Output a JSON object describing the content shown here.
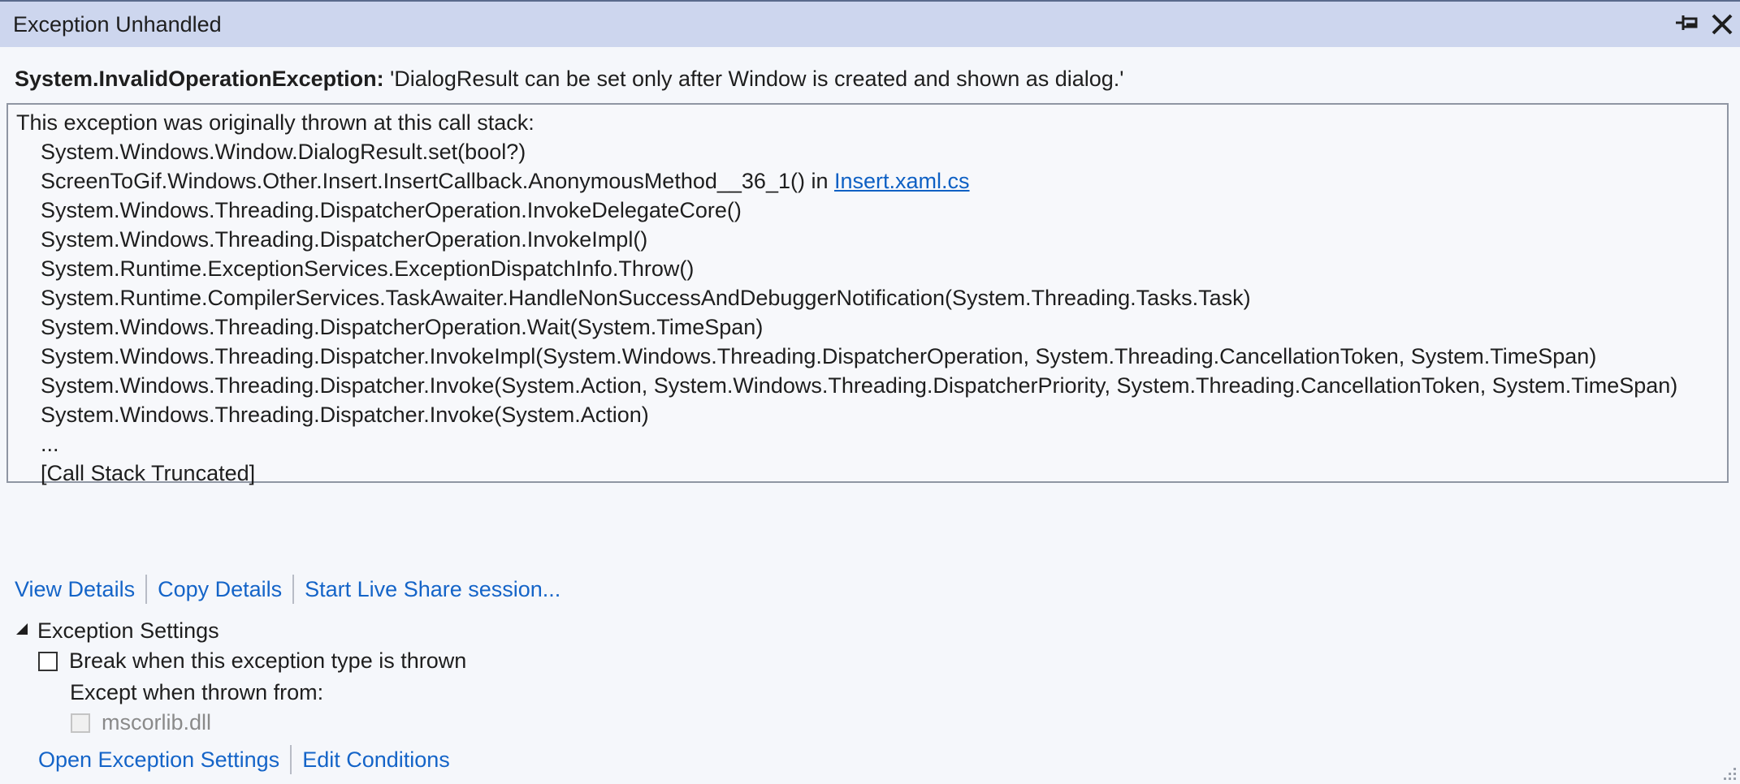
{
  "window": {
    "title": "Exception Unhandled"
  },
  "exception": {
    "type": "System.InvalidOperationException:",
    "message": "'DialogResult can be set only after Window is created and shown as dialog.'"
  },
  "call_stack": {
    "intro": "This exception was originally thrown at this call stack:",
    "frames": [
      {
        "text": "System.Windows.Window.DialogResult.set(bool?)"
      },
      {
        "text": "ScreenToGif.Windows.Other.Insert.InsertCallback.AnonymousMethod__36_1() in ",
        "link": "Insert.xaml.cs"
      },
      {
        "text": "System.Windows.Threading.DispatcherOperation.InvokeDelegateCore()"
      },
      {
        "text": "System.Windows.Threading.DispatcherOperation.InvokeImpl()"
      },
      {
        "text": "System.Runtime.ExceptionServices.ExceptionDispatchInfo.Throw()"
      },
      {
        "text": "System.Runtime.CompilerServices.TaskAwaiter.HandleNonSuccessAndDebuggerNotification(System.Threading.Tasks.Task)"
      },
      {
        "text": "System.Windows.Threading.DispatcherOperation.Wait(System.TimeSpan)"
      },
      {
        "text": "System.Windows.Threading.Dispatcher.InvokeImpl(System.Windows.Threading.DispatcherOperation, System.Threading.CancellationToken, System.TimeSpan)"
      },
      {
        "text": "System.Windows.Threading.Dispatcher.Invoke(System.Action, System.Windows.Threading.DispatcherPriority, System.Threading.CancellationToken, System.TimeSpan)"
      },
      {
        "text": "System.Windows.Threading.Dispatcher.Invoke(System.Action)"
      },
      {
        "text": "..."
      },
      {
        "text": "[Call Stack Truncated]"
      }
    ]
  },
  "actions": {
    "view_details": "View Details",
    "copy_details": "Copy Details",
    "live_share": "Start Live Share session..."
  },
  "exception_settings": {
    "header": "Exception Settings",
    "break_label": "Break when this exception type is thrown",
    "break_checked": false,
    "except_label": "Except when thrown from:",
    "module_label": "mscorlib.dll",
    "module_checked": false,
    "open_settings": "Open Exception Settings",
    "edit_conditions": "Edit Conditions"
  },
  "icons": {
    "pin": "pin-icon",
    "close": "close-icon",
    "expander": "expander-triangle-icon",
    "resize": "resize-grip-icon"
  },
  "colors": {
    "titlebar": "#cdd6ee",
    "link": "#1464c8",
    "background": "#f5f7fb"
  }
}
